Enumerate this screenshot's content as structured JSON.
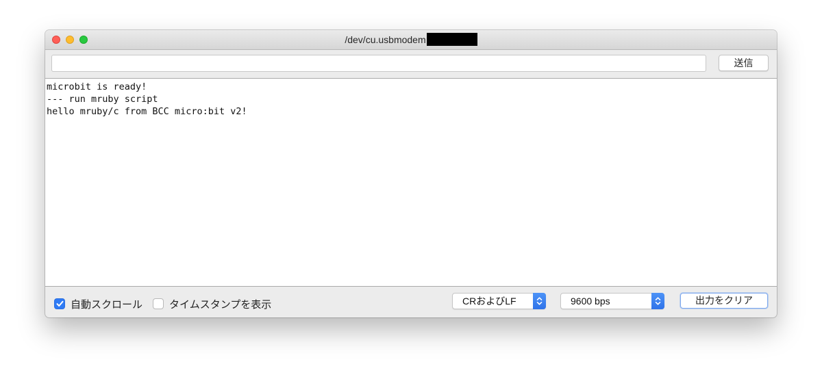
{
  "window": {
    "title": "/dev/cu.usbmodem"
  },
  "send": {
    "input_value": "",
    "button_label": "送信"
  },
  "output": {
    "lines": [
      "microbit is ready!",
      "--- run mruby script",
      "hello mruby/c from BCC micro:bit v2!"
    ]
  },
  "options": {
    "autoscroll_label": "自動スクロール",
    "autoscroll_checked": true,
    "timestamp_label": "タイムスタンプを表示",
    "timestamp_checked": false,
    "line_ending": "CRおよびLF",
    "baud_rate": "9600 bps",
    "clear_label": "出力をクリア"
  },
  "icons": {
    "checkmark": "checkmark-icon",
    "stepper": "up-down-chevron-icon"
  },
  "colors": {
    "accent": "#2f7bf5",
    "close": "#fe5f57",
    "minimize": "#febc2e",
    "zoom": "#28c840"
  }
}
